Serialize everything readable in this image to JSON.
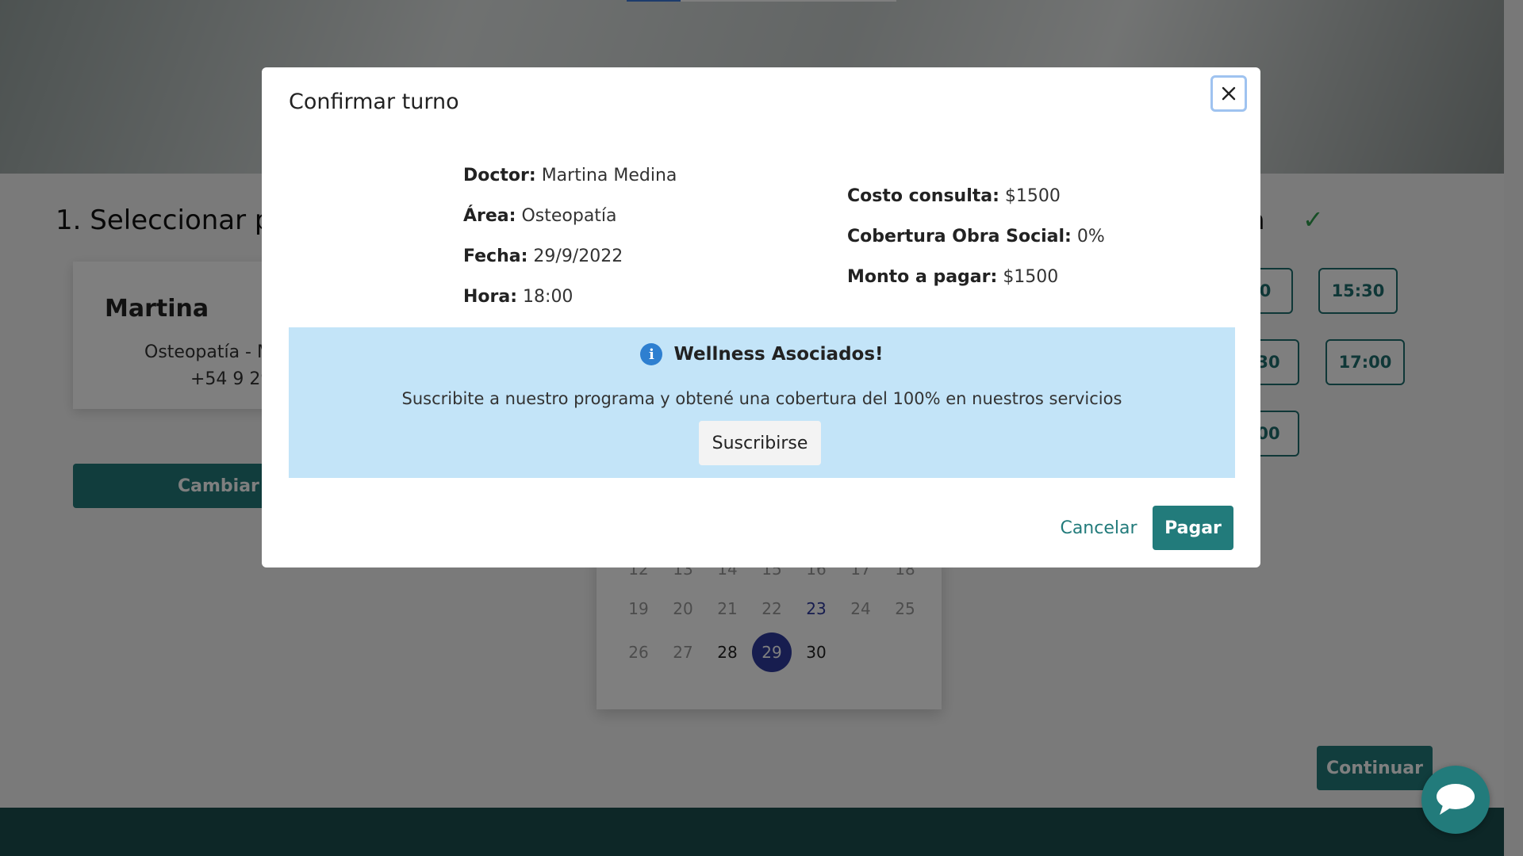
{
  "background": {
    "step1_title": "1. Seleccionar pro",
    "step3_title": "ra",
    "doctor_card": {
      "name": "Martina",
      "area": "Osteopatía - M",
      "phone": "+54 9 29"
    },
    "change_button": "Cambiar p",
    "time_slots": [
      "0",
      "15:30",
      "30",
      "17:00",
      "00"
    ],
    "calendar": {
      "row_partial": [
        "12",
        "13",
        "14",
        "15",
        "16",
        "17",
        "18"
      ],
      "row_3": [
        "19",
        "20",
        "21",
        "22",
        "23",
        "24",
        "25"
      ],
      "row_4": [
        "26",
        "27",
        "28",
        "29",
        "30"
      ]
    },
    "continue_button": "Continuar"
  },
  "modal": {
    "title": "Confirmar turno",
    "close_icon": "close-icon",
    "left": {
      "doctor_label": "Doctor:",
      "doctor_value": "Martina Medina",
      "area_label": "Área:",
      "area_value": "Osteopatía",
      "date_label": "Fecha:",
      "date_value": "29/9/2022",
      "time_label": "Hora:",
      "time_value": "18:00"
    },
    "right": {
      "cost_label": "Costo consulta:",
      "cost_value": "$1500",
      "coverage_label": "Cobertura Obra Social:",
      "coverage_value": "0%",
      "amount_label": "Monto a pagar:",
      "amount_value": "$1500"
    },
    "banner": {
      "icon": "info-icon",
      "title": "Wellness Asociados!",
      "text": "Suscribite a nuestro programa y obtené una cobertura del 100% en nuestros servicios",
      "button": "Suscribirse"
    },
    "cancel_button": "Cancelar",
    "pay_button": "Pagar"
  },
  "colors": {
    "primary": "#227b7b",
    "selected_day": "#2f3b9e",
    "banner_bg": "#c3e4f8",
    "info_icon": "#2e7fd0",
    "check": "#2e9c4c"
  }
}
